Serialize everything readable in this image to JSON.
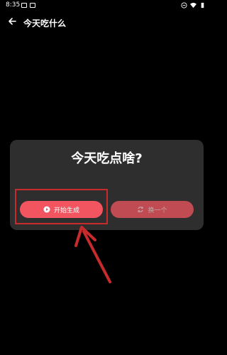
{
  "status_bar": {
    "time": "8:35",
    "icons": [
      "image-icon",
      "download-icon",
      "minus-circle-icon",
      "wifi-icon",
      "battery-icon"
    ]
  },
  "app_bar": {
    "back_icon": "arrow-left-icon",
    "title": "今天吃什么"
  },
  "dialog": {
    "title": "今天吃点啥?",
    "start_button": {
      "label": "开始生成",
      "icon": "play-circle-icon"
    },
    "swap_button": {
      "label": "换一个",
      "icon": "refresh-icon"
    }
  },
  "colors": {
    "background": "#000000",
    "dialog_bg": "#2e2e2e",
    "button": "#f25560",
    "annotation": "#c72b2b"
  }
}
